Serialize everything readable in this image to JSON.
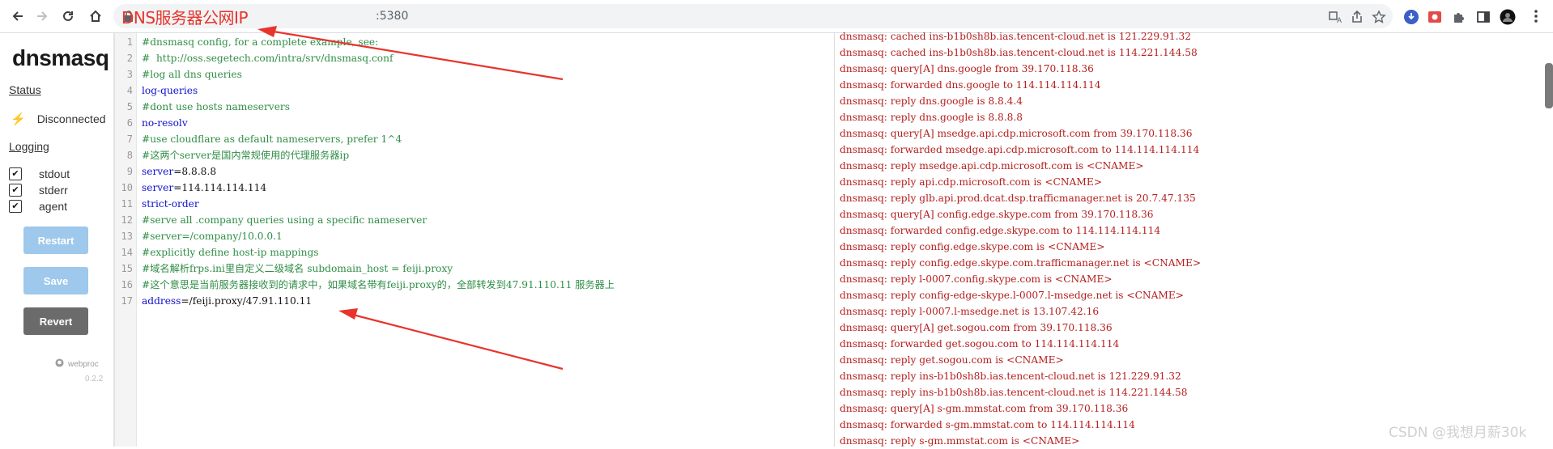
{
  "browser": {
    "url_suffix": ":5380",
    "url_annotation": "DNS服务器公网IP"
  },
  "sidebar": {
    "title": "dnsmasq",
    "status_heading": "Status",
    "status_text": "Disconnected",
    "logging_heading": "Logging",
    "logging_options": [
      {
        "label": "stdout",
        "checked": true
      },
      {
        "label": "stderr",
        "checked": true
      },
      {
        "label": "agent",
        "checked": true
      }
    ],
    "buttons": {
      "restart": "Restart",
      "save": "Save",
      "revert": "Revert"
    },
    "footer_link": "webproc",
    "footer_version": "0.2.2"
  },
  "editor": {
    "lines": [
      {
        "n": "1",
        "parts": [
          {
            "t": "#dnsmasq config, for a complete example, see:",
            "c": "comment"
          }
        ]
      },
      {
        "n": "2",
        "parts": [
          {
            "t": "#  http://oss.segetech.com/intra/srv/dnsmasq.conf",
            "c": "comment"
          }
        ]
      },
      {
        "n": "3",
        "parts": [
          {
            "t": "#log all dns queries",
            "c": "comment"
          }
        ]
      },
      {
        "n": "4",
        "parts": [
          {
            "t": "log-queries",
            "c": "kw"
          }
        ]
      },
      {
        "n": "5",
        "parts": [
          {
            "t": "#dont use hosts nameservers",
            "c": "comment"
          }
        ]
      },
      {
        "n": "6",
        "parts": [
          {
            "t": "no-resolv",
            "c": "kw"
          }
        ]
      },
      {
        "n": "7",
        "parts": [
          {
            "t": "#use cloudflare as default nameservers, prefer 1^4",
            "c": "comment"
          }
        ]
      },
      {
        "n": "8",
        "parts": [
          {
            "t": "#这两个server是国内常规使用的代理服务器ip",
            "c": "comment"
          }
        ]
      },
      {
        "n": "9",
        "parts": [
          {
            "t": "server",
            "c": "kw"
          },
          {
            "t": "=8.8.8.8",
            "c": "val"
          }
        ]
      },
      {
        "n": "10",
        "parts": [
          {
            "t": "server",
            "c": "kw"
          },
          {
            "t": "=114.114.114.114",
            "c": "val"
          }
        ]
      },
      {
        "n": "11",
        "parts": [
          {
            "t": "strict-order",
            "c": "kw"
          }
        ]
      },
      {
        "n": "12",
        "parts": [
          {
            "t": "#serve all .company queries using a specific nameserver",
            "c": "comment"
          }
        ]
      },
      {
        "n": "13",
        "parts": [
          {
            "t": "#server=/company/10.0.0.1",
            "c": "comment"
          }
        ]
      },
      {
        "n": "14",
        "parts": [
          {
            "t": "#explicitly define host-ip mappings",
            "c": "comment"
          }
        ]
      },
      {
        "n": "15",
        "parts": [
          {
            "t": "#域名解析frps.ini里自定义二级域名 subdomain_host = feiji.proxy",
            "c": "comment"
          }
        ]
      },
      {
        "n": "16",
        "parts": [
          {
            "t": "#这个意思是当前服务器接收到的请求中，如果域名带有feiji.proxy的，全部转发到47.91.110.11 服务器上",
            "c": "comment"
          }
        ]
      },
      {
        "n": "17",
        "parts": [
          {
            "t": "address",
            "c": "kw"
          },
          {
            "t": "=/feiji.proxy/47.91.110.11",
            "c": "val"
          }
        ]
      }
    ]
  },
  "log": {
    "lines": [
      "dnsmasq: cached ins-b1b0sh8b.ias.tencent-cloud.net is 121.229.91.32",
      "dnsmasq: cached ins-b1b0sh8b.ias.tencent-cloud.net is 114.221.144.58",
      "dnsmasq: query[A] dns.google from 39.170.118.36",
      "dnsmasq: forwarded dns.google to 114.114.114.114",
      "dnsmasq: reply dns.google is 8.8.4.4",
      "dnsmasq: reply dns.google is 8.8.8.8",
      "dnsmasq: query[A] msedge.api.cdp.microsoft.com from 39.170.118.36",
      "dnsmasq: forwarded msedge.api.cdp.microsoft.com to 114.114.114.114",
      "dnsmasq: reply msedge.api.cdp.microsoft.com is <CNAME>",
      "dnsmasq: reply api.cdp.microsoft.com is <CNAME>",
      "dnsmasq: reply glb.api.prod.dcat.dsp.trafficmanager.net is 20.7.47.135",
      "dnsmasq: query[A] config.edge.skype.com from 39.170.118.36",
      "dnsmasq: forwarded config.edge.skype.com to 114.114.114.114",
      "dnsmasq: reply config.edge.skype.com is <CNAME>",
      "dnsmasq: reply config.edge.skype.com.trafficmanager.net is <CNAME>",
      "dnsmasq: reply l-0007.config.skype.com is <CNAME>",
      "dnsmasq: reply config-edge-skype.l-0007.l-msedge.net is <CNAME>",
      "dnsmasq: reply l-0007.l-msedge.net is 13.107.42.16",
      "dnsmasq: query[A] get.sogou.com from 39.170.118.36",
      "dnsmasq: forwarded get.sogou.com to 114.114.114.114",
      "dnsmasq: reply get.sogou.com is <CNAME>",
      "dnsmasq: reply ins-b1b0sh8b.ias.tencent-cloud.net is 121.229.91.32",
      "dnsmasq: reply ins-b1b0sh8b.ias.tencent-cloud.net is 114.221.144.58",
      "dnsmasq: query[A] s-gm.mmstat.com from 39.170.118.36",
      "dnsmasq: forwarded s-gm.mmstat.com to 114.114.114.114",
      "dnsmasq: reply s-gm.mmstat.com is <CNAME>"
    ]
  },
  "watermark": "CSDN @我想月薪30k",
  "colors": {
    "annotation": "#e8342c",
    "log_text": "#b41e1e",
    "comment": "#2f8d46",
    "keyword": "#1010d0"
  }
}
